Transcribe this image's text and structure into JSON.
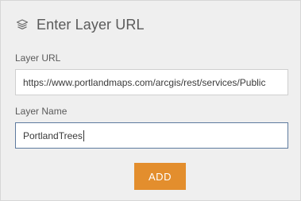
{
  "dialog": {
    "title": "Enter Layer URL",
    "icon": "layers-icon"
  },
  "layer_url": {
    "label": "Layer URL",
    "value": "https://www.portlandmaps.com/arcgis/rest/services/Public"
  },
  "layer_name": {
    "label": "Layer Name",
    "value": "PortlandTrees"
  },
  "actions": {
    "add_label": "ADD"
  },
  "colors": {
    "panel_background": "#efefef",
    "add_button": "#e38e2d",
    "focused_border": "#5e7a9e",
    "text": "#5a5a5a"
  }
}
